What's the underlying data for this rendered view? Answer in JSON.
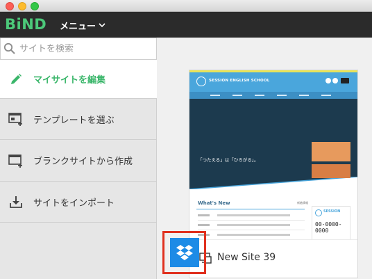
{
  "app": {
    "logo_text": "BiND",
    "menu_label": "メニュー"
  },
  "sidebar": {
    "search_placeholder": "サイトを検索",
    "items": [
      {
        "label": "マイサイトを編集",
        "icon": "pencil-icon",
        "active": true
      },
      {
        "label": "テンプレートを選ぶ",
        "icon": "template-icon",
        "active": false
      },
      {
        "label": "ブランクサイトから作成",
        "icon": "blank-site-icon",
        "active": false
      },
      {
        "label": "サイトをインポート",
        "icon": "import-icon",
        "active": false
      }
    ]
  },
  "site_card": {
    "name": "New Site 39",
    "thumbnail": {
      "school_name": "SESSION ENGLISH SCHOOL",
      "hero_text": "「つたえる」は「ひろがる」。",
      "section_title": "What's New",
      "list_link": "新着情報",
      "side_title": "SESSION",
      "phone": "00-0000-0000"
    },
    "dropbox_icon": "dropbox-icon"
  },
  "colors": {
    "accent_green": "#3ab66a",
    "logo_green": "#4cc97a",
    "topbar_bg": "#2b2b2b",
    "dropbox_blue": "#1d8be6",
    "highlight_red": "#e0301e"
  }
}
